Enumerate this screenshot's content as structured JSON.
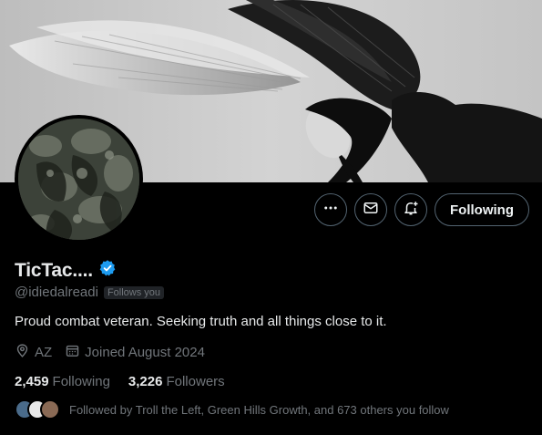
{
  "profile": {
    "display_name": "TicTac....",
    "handle": "@idiedalreadi",
    "follows_you_badge": "Follows you",
    "bio": "Proud combat veteran. Seeking truth and all things close to it.",
    "location": "AZ",
    "joined": "Joined August 2024",
    "verified_color": "#1d9bf0"
  },
  "actions": {
    "more_icon": "more-dots-icon",
    "message_icon": "envelope-icon",
    "notify_icon": "bell-plus-icon",
    "follow_label": "Following"
  },
  "stats": {
    "following_count": "2,459",
    "following_label": "Following",
    "followers_count": "3,226",
    "followers_label": "Followers"
  },
  "followed_by": {
    "text": "Followed by Troll the Left, Green Hills Growth, and 673 others you follow"
  },
  "colors": {
    "background": "#000000",
    "text_primary": "#e7e9ea",
    "text_secondary": "#71767b",
    "border": "#536471"
  }
}
